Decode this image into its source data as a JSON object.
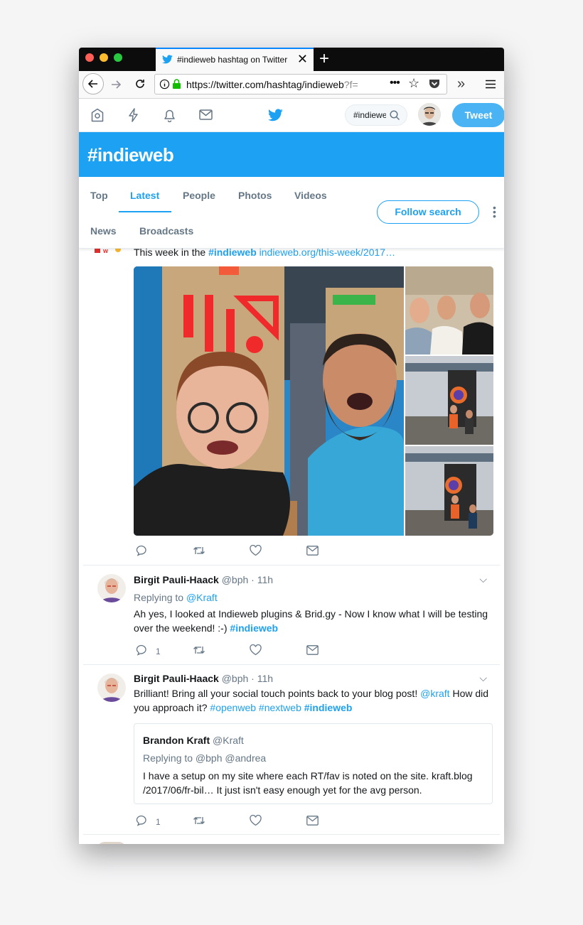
{
  "browser": {
    "tab_title": "#indieweb hashtag on Twitter",
    "url": "https://twitter.com/hashtag/indieweb",
    "url_tail": "?f="
  },
  "twitter": {
    "search_value": "#indieweb",
    "tweet_button": "Tweet",
    "hashtag_title": "#indieweb",
    "tabs": [
      {
        "label": "Top"
      },
      {
        "label": "Latest"
      },
      {
        "label": "People"
      },
      {
        "label": "Photos"
      },
      {
        "label": "Videos"
      },
      {
        "label": "News"
      },
      {
        "label": "Broadcasts"
      }
    ],
    "follow_button": "Follow search"
  },
  "tweets": [
    {
      "text_prefix": "This week in the ",
      "hashtag": "#indieweb",
      "link": "indieweb.org/this-week/2017…",
      "actions": {
        "reply_count": "",
        "retweet_count": ""
      }
    },
    {
      "name": "Birgit Pauli-Haack",
      "meta": "@bph · 11h",
      "reply_prefix": "Replying to ",
      "reply_to": "@Kraft",
      "text": "Ah yes, I looked at Indieweb plugins & Brid.gy - Now I know what I will be testing over the weekend! :-) ",
      "hashtag": "#indieweb",
      "reply_count": "1"
    },
    {
      "name": "Birgit Pauli-Haack",
      "meta": "@bph · 11h",
      "text_prefix": "Brilliant! Bring all your social touch points back to your blog post! ",
      "mention": "@kraft",
      "text_mid": "  How did you approach it? ",
      "tag1": "#openweb",
      "tag2": "#nextweb",
      "hashtag": "#indieweb",
      "quote": {
        "name": "Brandon Kraft",
        "handle": "@Kraft",
        "reply_line": "Replying to @bph @andrea",
        "text": "I have a setup on my site where each RT/fav is noted on the site. kraft.blog /2017/06/fr-bil… It just isn't easy enough yet for the avg person."
      },
      "reply_count": "1"
    }
  ],
  "colors": {
    "twitter_blue": "#1da1f2",
    "tweet_button": "#4ab3f4",
    "text": "#14171a",
    "muted": "#657786"
  }
}
